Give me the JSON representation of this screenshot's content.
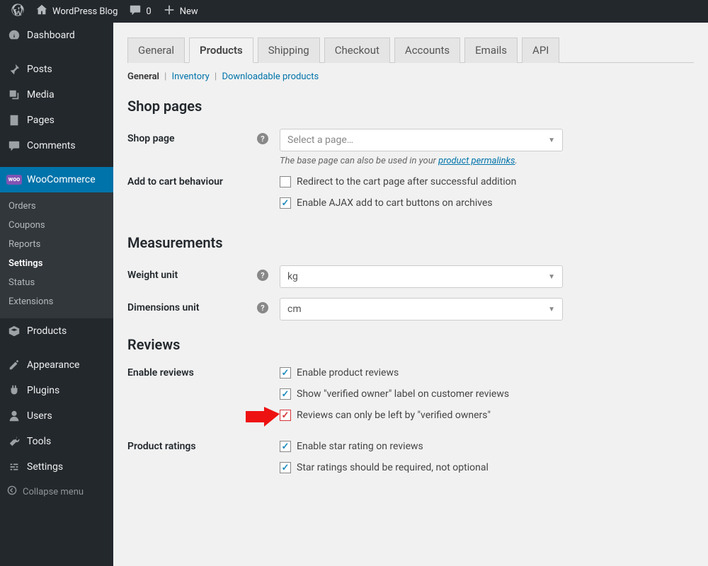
{
  "adminbar": {
    "site_name": "WordPress Blog",
    "comments_count": "0",
    "new_label": "New"
  },
  "sidebar": {
    "items": [
      {
        "label": "Dashboard",
        "icon": "dashboard"
      },
      {
        "label": "Posts",
        "icon": "pin"
      },
      {
        "label": "Media",
        "icon": "media"
      },
      {
        "label": "Pages",
        "icon": "pages"
      },
      {
        "label": "Comments",
        "icon": "comment"
      },
      {
        "label": "WooCommerce",
        "icon": "woo",
        "current": true
      },
      {
        "label": "Products",
        "icon": "products"
      },
      {
        "label": "Appearance",
        "icon": "appearance"
      },
      {
        "label": "Plugins",
        "icon": "plugins"
      },
      {
        "label": "Users",
        "icon": "users"
      },
      {
        "label": "Tools",
        "icon": "tools"
      },
      {
        "label": "Settings",
        "icon": "settings"
      }
    ],
    "woo_submenu": [
      "Orders",
      "Coupons",
      "Reports",
      "Settings",
      "Status",
      "Extensions"
    ],
    "woo_submenu_current": "Settings",
    "collapse_label": "Collapse menu"
  },
  "tabs": [
    "General",
    "Products",
    "Shipping",
    "Checkout",
    "Accounts",
    "Emails",
    "API"
  ],
  "tabs_active": "Products",
  "subnav": [
    "General",
    "Inventory",
    "Downloadable products"
  ],
  "subnav_current": "General",
  "sections": {
    "shop_pages": {
      "heading": "Shop pages",
      "shop_page_label": "Shop page",
      "shop_page_placeholder": "Select a page…",
      "shop_page_help": "The base page can also be used in your ",
      "shop_page_help_link": "product permalinks",
      "add_to_cart_label": "Add to cart behaviour",
      "redirect_label": "Redirect to the cart page after successful addition",
      "ajax_label": "Enable AJAX add to cart buttons on archives"
    },
    "measurements": {
      "heading": "Measurements",
      "weight_label": "Weight unit",
      "weight_value": "kg",
      "dimensions_label": "Dimensions unit",
      "dimensions_value": "cm"
    },
    "reviews": {
      "heading": "Reviews",
      "enable_reviews_label": "Enable reviews",
      "enable_product_reviews": "Enable product reviews",
      "verified_owner_label": "Show \"verified owner\" label on customer reviews",
      "verified_only": "Reviews can only be left by \"verified owners\"",
      "product_ratings_label": "Product ratings",
      "enable_star": "Enable star rating on reviews",
      "star_required": "Star ratings should be required, not optional"
    }
  }
}
